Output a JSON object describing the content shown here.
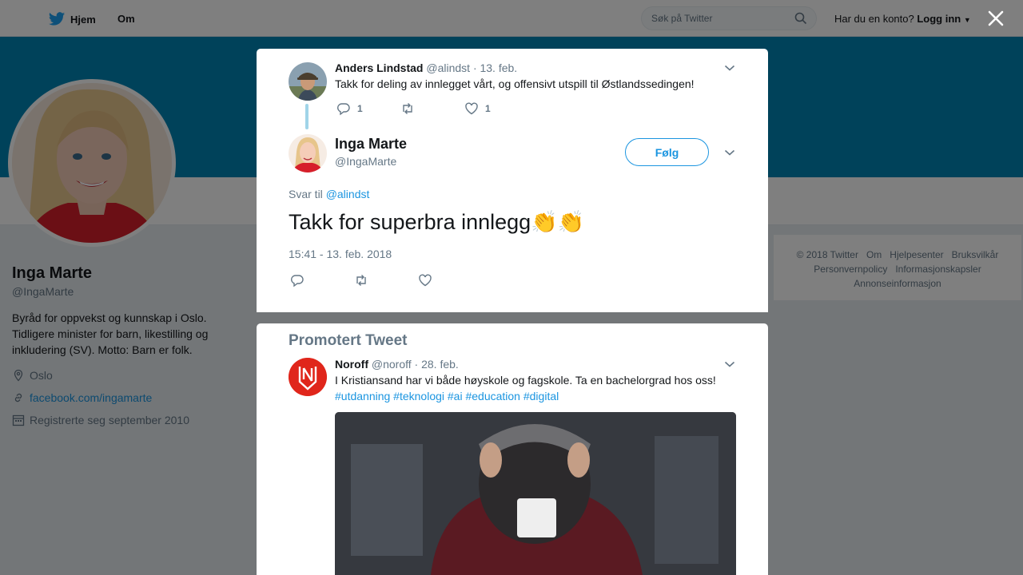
{
  "topbar": {
    "home_label": "Hjem",
    "about_label": "Om",
    "search_placeholder": "Søk på Twitter",
    "account_question": "Har du en konto?",
    "login_label": "Logg inn"
  },
  "profile": {
    "name": "Inga Marte",
    "handle": "@IngaMarte",
    "bio": "Byråd for oppvekst og kunnskap i Oslo. Tidligere minister for barn, likestilling og inkludering (SV). Motto: Barn er folk.",
    "location": "Oslo",
    "website": "facebook.com/ingamarte",
    "joined": "Registrerte seg september 2010"
  },
  "footer": {
    "links": [
      "© 2018 Twitter",
      "Om",
      "Hjelpesenter",
      "Bruksvilkår",
      "Personvernpolicy",
      "Informasjonskapsler",
      "Annonseinformasjon"
    ]
  },
  "parent_tweet": {
    "name": "Anders Lindstad",
    "handle": "@alindst",
    "date": "· 13. feb.",
    "text": "Takk for deling av innlegget vårt, og offensivt utspill til Østlandssedingen!",
    "reply_count": "1",
    "like_count": "1"
  },
  "main_tweet": {
    "name": "Inga Marte",
    "handle": "@IngaMarte",
    "follow_label": "Følg",
    "reply_prefix": "Svar til",
    "reply_to": "@alindst",
    "text": "Takk for superbra innlegg👏👏",
    "timestamp": "15:41 - 13. feb. 2018"
  },
  "promoted": {
    "heading": "Promotert Tweet",
    "name": "Noroff",
    "handle": "@noroff",
    "date": "· 28. feb.",
    "text": "I Kristiansand har vi både høyskole og fagskole. Ta en bachelorgrad hos oss!",
    "hashtags": "#utdanning #teknologi #ai #education #digital"
  },
  "colors": {
    "accent": "#1b95e0",
    "banner": "#0084b4",
    "noroff": "#e0261b"
  }
}
